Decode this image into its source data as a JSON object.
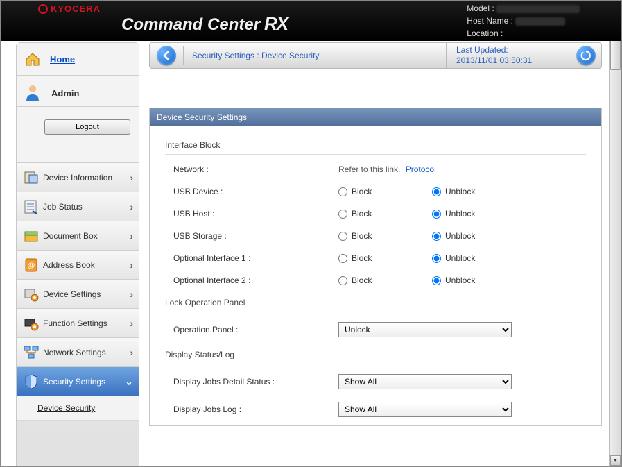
{
  "brand": "KYOCERA",
  "product_title": "Command Center",
  "product_suffix": "RX",
  "header_info": {
    "model_label": "Model :",
    "hostname_label": "Host Name :",
    "location_label": "Location :"
  },
  "sidebar": {
    "home": "Home",
    "admin": "Admin",
    "logout": "Logout",
    "items": [
      {
        "label": "Device Information"
      },
      {
        "label": "Job Status"
      },
      {
        "label": "Document Box"
      },
      {
        "label": "Address Book"
      },
      {
        "label": "Device Settings"
      },
      {
        "label": "Function Settings"
      },
      {
        "label": "Network Settings"
      },
      {
        "label": "Security Settings"
      }
    ],
    "sub_item": "Device Security"
  },
  "breadcrumb": "Security Settings : Device Security",
  "last_updated_label": "Last Updated:",
  "last_updated_value": "2013/11/01 03:50:31",
  "panel": {
    "title": "Device Security Settings",
    "section1": {
      "title": "Interface Block",
      "network_label": "Network :",
      "network_text": "Refer to this link.",
      "network_link": "Protocol",
      "rows": [
        {
          "label": "USB Device :"
        },
        {
          "label": "USB Host :"
        },
        {
          "label": "USB Storage :"
        },
        {
          "label": "Optional Interface 1 :"
        },
        {
          "label": "Optional Interface 2 :"
        }
      ],
      "block": "Block",
      "unblock": "Unblock"
    },
    "section2": {
      "title": "Lock Operation Panel",
      "op_label": "Operation Panel :",
      "op_value": "Unlock"
    },
    "section3": {
      "title": "Display Status/Log",
      "row1_label": "Display Jobs Detail Status :",
      "row1_value": "Show All",
      "row2_label": "Display Jobs Log :",
      "row2_value": "Show All"
    }
  }
}
